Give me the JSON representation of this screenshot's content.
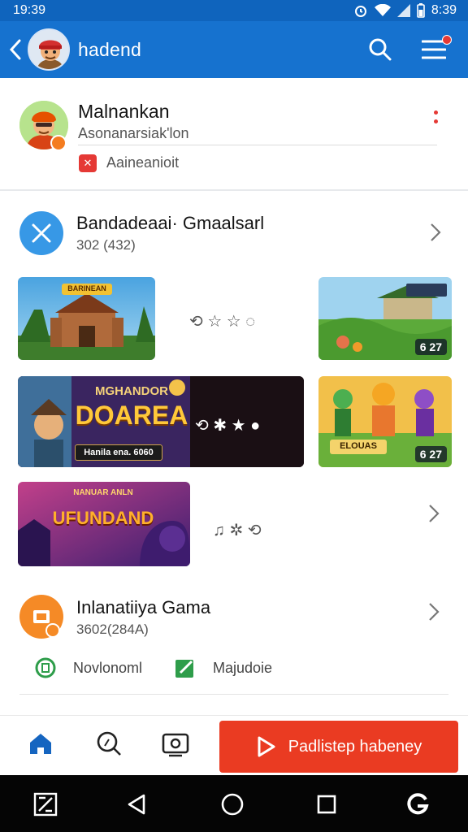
{
  "status_bar": {
    "time_left": "19:39",
    "time_right": "8:39"
  },
  "app_bar": {
    "title": "hadend"
  },
  "profile": {
    "name": "Malnankan",
    "subtitle": "Asonanarsiak'lon",
    "tag": "Aaineanioit"
  },
  "category": {
    "title": "Bandadeaai· Gmaalsarl",
    "count": "302 (432)"
  },
  "tiles": {
    "t1_title": "BARINEAN",
    "t1_glyphs": "⟲ ☆ ☆ ◌",
    "t2_score": "6 27",
    "t3_title_top": "MGHANDOR",
    "t3_title_main": "DOAREA",
    "t3_caption": "Hanila ena. 6060",
    "t3_glyphs": "⟲ ✱ ★ ●",
    "t4_label": "ELOUAS",
    "t4_score": "6 27",
    "t5_title_top": "NANUAR ANLN",
    "t5_title_main": "UFUNDAND",
    "t5_glyphs": "♫ ✲ ⟲"
  },
  "category2": {
    "title": "Inlanatiiya Gama",
    "count": "3602(284A)",
    "chip1": "Novlonoml",
    "chip2": "Majudoie"
  },
  "bottom_nav": {
    "play_label": "Padlistep habeney"
  },
  "colors": {
    "app_bar": "#1672cf",
    "status_bar": "#0f64bd",
    "accent_red": "#ea3b22",
    "home_icon": "#1565c0"
  },
  "icons": {
    "back": "chevron-left-icon",
    "search": "search-icon",
    "menu": "hamburger-menu-icon",
    "home": "home-icon",
    "explore": "search-icon",
    "media": "photo-icon",
    "play": "play-icon"
  }
}
